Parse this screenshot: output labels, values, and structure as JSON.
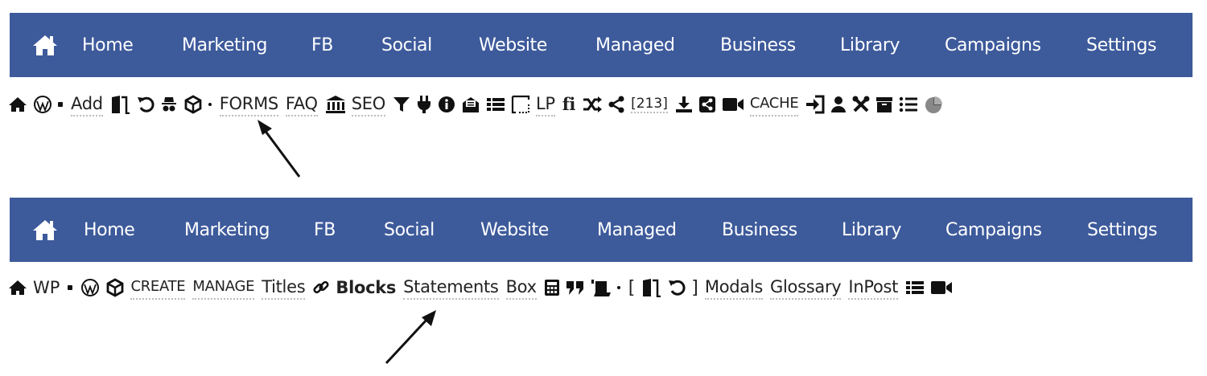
{
  "colors": {
    "nav_bg": "#3d5a9b",
    "nav_text": "#ffffff",
    "toolbar_text": "#222222"
  },
  "top_panel": {
    "nav": {
      "home_icon": "home-icon",
      "items": [
        "Home",
        "Marketing",
        "FB",
        "Social",
        "Website",
        "Managed",
        "Business",
        "Library",
        "Campaigns",
        "Settings"
      ]
    },
    "toolbar": {
      "add_label": "Add",
      "forms_label": "FORMS",
      "faq_label": "FAQ",
      "seo_label": "SEO",
      "lp_label": "LP",
      "fi_label": "fi",
      "count_label": "[213]",
      "cache_label": "CACHE"
    }
  },
  "bottom_panel": {
    "nav": {
      "home_icon": "home-icon",
      "items": [
        "Home",
        "Marketing",
        "FB",
        "Social",
        "Website",
        "Managed",
        "Business",
        "Library",
        "Campaigns",
        "Settings"
      ]
    },
    "toolbar": {
      "wp_label": "WP",
      "create_label": "CREATE",
      "manage_label": "MANAGE",
      "titles_label": "Titles",
      "blocks_label": "Blocks",
      "statements_label": "Statements",
      "box_label": "Box",
      "bracket_open": "[",
      "bracket_close": "]",
      "modals_label": "Modals",
      "glossary_label": "Glossary",
      "inpost_label": "InPost"
    }
  }
}
